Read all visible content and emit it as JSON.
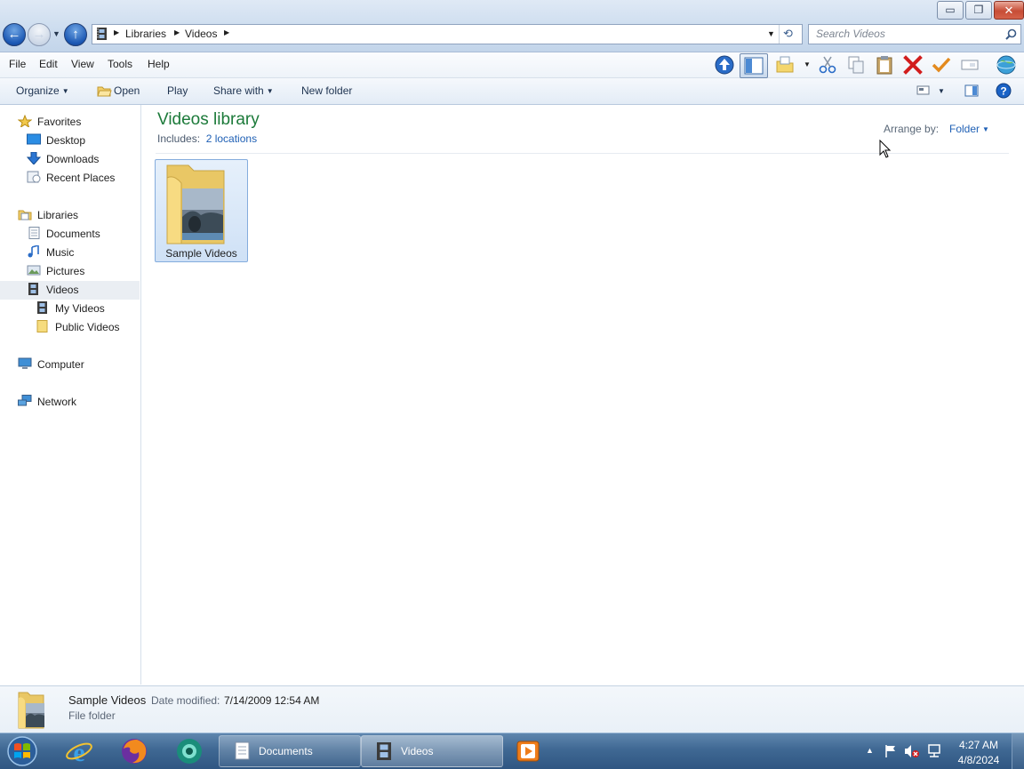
{
  "window": {
    "minimize_glyph": "▭",
    "restore_glyph": "❐",
    "close_glyph": "✕"
  },
  "address": {
    "crumbs": [
      "Libraries",
      "Videos"
    ],
    "search_placeholder": "Search Videos"
  },
  "menu": [
    "File",
    "Edit",
    "View",
    "Tools",
    "Help"
  ],
  "toolbar_icons": [
    "up-arrow-icon",
    "preview-pane-icon",
    "new-folder-icon",
    "cut-icon",
    "copy-icon",
    "paste-icon",
    "delete-icon",
    "checkmark-icon",
    "rename-icon",
    "globe-icon"
  ],
  "commandbar": {
    "organize": "Organize",
    "open": "Open",
    "play": "Play",
    "share_with": "Share with",
    "new_folder": "New folder"
  },
  "nav": {
    "favorites": "Favorites",
    "desktop": "Desktop",
    "downloads": "Downloads",
    "recent_places": "Recent Places",
    "libraries": "Libraries",
    "documents": "Documents",
    "music": "Music",
    "pictures": "Pictures",
    "videos": "Videos",
    "my_videos": "My Videos",
    "public_videos": "Public Videos",
    "computer": "Computer",
    "network": "Network"
  },
  "content": {
    "title": "Videos library",
    "includes_label": "Includes:",
    "includes_link": "2 locations",
    "arrange_label": "Arrange by:",
    "arrange_value": "Folder",
    "items": [
      {
        "name": "Sample Videos"
      }
    ]
  },
  "details": {
    "name": "Sample Videos",
    "date_label": "Date modified:",
    "date_value": "7/14/2009 12:54 AM",
    "type": "File folder"
  },
  "taskbar": {
    "tasks": [
      {
        "label": "Documents"
      },
      {
        "label": "Videos"
      }
    ],
    "time": "4:27 AM",
    "date": "4/8/2024"
  },
  "colors": {
    "library_title": "#1c7a3a",
    "link": "#1f60b5",
    "taskbar": "#3f6893"
  }
}
